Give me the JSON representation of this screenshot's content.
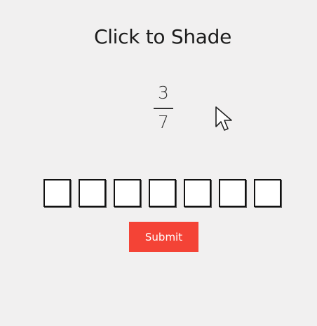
{
  "title": "Click to Shade",
  "fraction": {
    "numerator": "3",
    "denominator": "7"
  },
  "boxes": [
    {
      "shaded": false
    },
    {
      "shaded": false
    },
    {
      "shaded": false
    },
    {
      "shaded": false
    },
    {
      "shaded": false
    },
    {
      "shaded": false
    },
    {
      "shaded": false
    }
  ],
  "submit_label": "Submit",
  "colors": {
    "background": "#f1f0f0",
    "accent": "#f44336",
    "box_fill": "#ffffff",
    "box_border": "#111111"
  }
}
